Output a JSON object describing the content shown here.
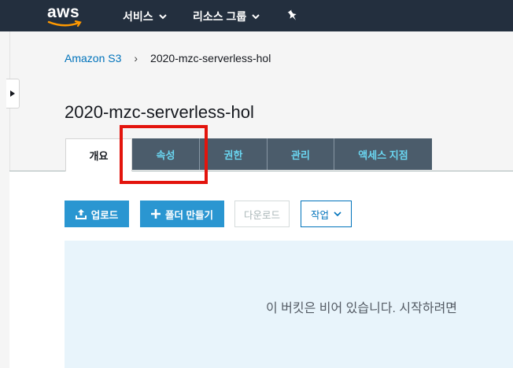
{
  "nav": {
    "logo_text": "aws",
    "services_label": "서비스",
    "resource_groups_label": "리소스 그룹"
  },
  "breadcrumb": {
    "root": "Amazon S3",
    "separator": "›",
    "current": "2020-mzc-serverless-hol"
  },
  "page_title": "2020-mzc-serverless-hol",
  "tabs": [
    {
      "label": "개요",
      "active": true
    },
    {
      "label": "속성",
      "active": false
    },
    {
      "label": "권한",
      "active": false
    },
    {
      "label": "관리",
      "active": false
    },
    {
      "label": "액세스 지점",
      "active": false
    }
  ],
  "actions": {
    "upload": "업로드",
    "create_folder": "폴더 만들기",
    "download": "다운로드",
    "actions_menu": "작업"
  },
  "empty_message": "이 버킷은 비어 있습니다. 시작하려면",
  "colors": {
    "nav_bg": "#232f3e",
    "tab_bg": "#4b5c6b",
    "tab_text": "#6ad6f1",
    "primary": "#2a96d1",
    "link": "#0073bb",
    "highlight": "#e3140d",
    "empty_panel": "#e8f4fb"
  }
}
